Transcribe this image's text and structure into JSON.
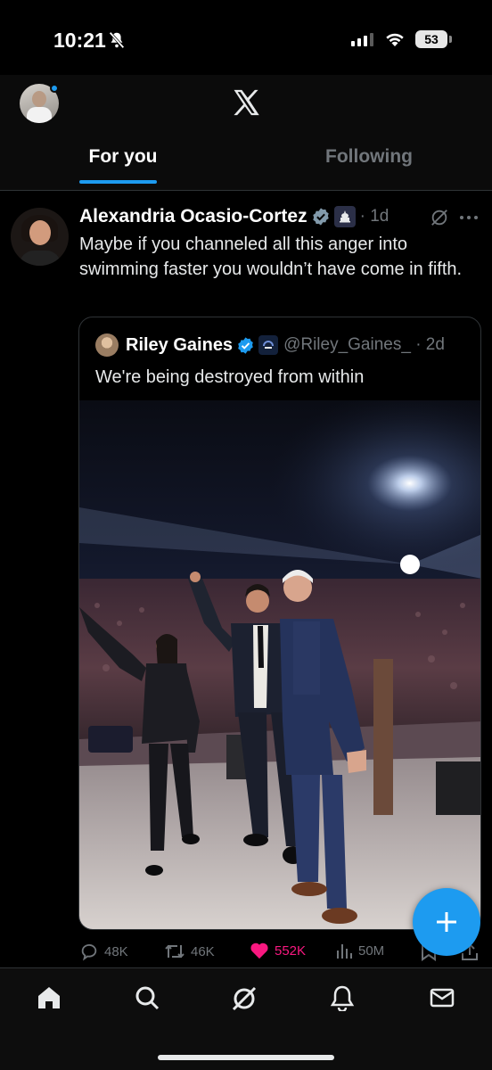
{
  "status_bar": {
    "time": "10:21",
    "battery": "53"
  },
  "header": {
    "tabs": [
      {
        "label": "For you",
        "active": true
      },
      {
        "label": "Following",
        "active": false
      }
    ]
  },
  "post": {
    "author": "Alexandria Ocasio-Cortez",
    "time": "· 1d",
    "text": "Maybe if you channeled all this anger into swimming faster you wouldn’t have come in fifth.",
    "quote": {
      "author": "Riley Gaines",
      "handle": "@Riley_Gaines_ · 2d",
      "text": "We're being destroyed from within"
    },
    "actions": {
      "replies": "48K",
      "reposts": "46K",
      "likes": "552K",
      "views": "50M"
    }
  },
  "nav": [
    "home-icon",
    "search-icon",
    "grok-icon",
    "notifications-icon",
    "messages-icon"
  ],
  "colors": {
    "accent": "#1d9bf0",
    "like": "#f91880",
    "muted": "#71767b",
    "background": "#000000"
  }
}
